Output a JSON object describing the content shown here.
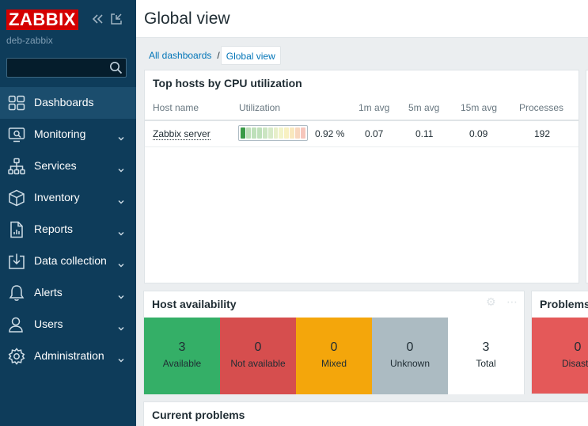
{
  "app": {
    "logo": "ZABBIX",
    "hostname": "deb-zabbix",
    "search": {
      "value": "",
      "placeholder": ""
    }
  },
  "nav": [
    {
      "label": "Dashboards",
      "icon": "dashboards-icon",
      "active": true,
      "has_children": false
    },
    {
      "label": "Monitoring",
      "icon": "monitoring-icon",
      "active": false,
      "has_children": true
    },
    {
      "label": "Services",
      "icon": "services-icon",
      "active": false,
      "has_children": true
    },
    {
      "label": "Inventory",
      "icon": "inventory-icon",
      "active": false,
      "has_children": true
    },
    {
      "label": "Reports",
      "icon": "reports-icon",
      "active": false,
      "has_children": true
    },
    {
      "label": "Data collection",
      "icon": "data-collection-icon",
      "active": false,
      "has_children": true
    },
    {
      "label": "Alerts",
      "icon": "alerts-icon",
      "active": false,
      "has_children": true
    },
    {
      "label": "Users",
      "icon": "users-icon",
      "active": false,
      "has_children": true
    },
    {
      "label": "Administration",
      "icon": "administration-icon",
      "active": false,
      "has_children": true
    }
  ],
  "header": {
    "title": "Global view"
  },
  "breadcrumb": {
    "items": [
      "All dashboards",
      "Global view"
    ],
    "separator": "/"
  },
  "top_hosts": {
    "title": "Top hosts by CPU utilization",
    "columns": [
      "Host name",
      "Utilization",
      "1m avg",
      "5m avg",
      "15m avg",
      "Processes"
    ],
    "rows": [
      {
        "host": "Zabbix server",
        "utilization": "0.92 %",
        "utilization_fraction": 0.0092,
        "avg1": "0.07",
        "avg5": "0.11",
        "avg15": "0.09",
        "processes": "192"
      }
    ]
  },
  "host_availability": {
    "title": "Host availability",
    "cells": [
      {
        "count": "3",
        "label": "Available",
        "bg": "#34af67",
        "fg": "#1f2c33"
      },
      {
        "count": "0",
        "label": "Not available",
        "bg": "#d64e4e",
        "fg": "#1f2c33"
      },
      {
        "count": "0",
        "label": "Mixed",
        "bg": "#f4a60b",
        "fg": "#1f2c33"
      },
      {
        "count": "0",
        "label": "Unknown",
        "bg": "#acbbc2",
        "fg": "#1f2c33"
      },
      {
        "count": "3",
        "label": "Total",
        "bg": "#ffffff",
        "fg": "#1f2c33"
      }
    ]
  },
  "problems_by_severity": {
    "title": "Problems",
    "cells": [
      {
        "count": "0",
        "label": "Disaste",
        "bg": "#e45959"
      }
    ]
  },
  "current_problems": {
    "title": "Current problems"
  },
  "colors": {
    "sidebar": "#0e3c5a",
    "sidebar_active": "#1b4d6d",
    "logo": "#d40000",
    "link": "#0275b8"
  }
}
